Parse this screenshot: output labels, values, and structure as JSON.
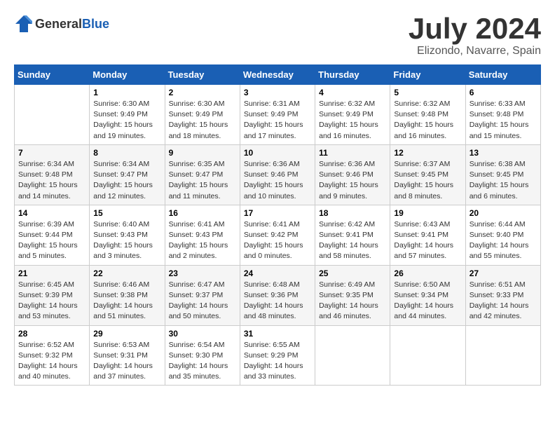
{
  "logo": {
    "general": "General",
    "blue": "Blue"
  },
  "title": "July 2024",
  "location": "Elizondo, Navarre, Spain",
  "days_header": [
    "Sunday",
    "Monday",
    "Tuesday",
    "Wednesday",
    "Thursday",
    "Friday",
    "Saturday"
  ],
  "weeks": [
    [
      {
        "day": "",
        "info": ""
      },
      {
        "day": "1",
        "info": "Sunrise: 6:30 AM\nSunset: 9:49 PM\nDaylight: 15 hours\nand 19 minutes."
      },
      {
        "day": "2",
        "info": "Sunrise: 6:30 AM\nSunset: 9:49 PM\nDaylight: 15 hours\nand 18 minutes."
      },
      {
        "day": "3",
        "info": "Sunrise: 6:31 AM\nSunset: 9:49 PM\nDaylight: 15 hours\nand 17 minutes."
      },
      {
        "day": "4",
        "info": "Sunrise: 6:32 AM\nSunset: 9:49 PM\nDaylight: 15 hours\nand 16 minutes."
      },
      {
        "day": "5",
        "info": "Sunrise: 6:32 AM\nSunset: 9:48 PM\nDaylight: 15 hours\nand 16 minutes."
      },
      {
        "day": "6",
        "info": "Sunrise: 6:33 AM\nSunset: 9:48 PM\nDaylight: 15 hours\nand 15 minutes."
      }
    ],
    [
      {
        "day": "7",
        "info": "Sunrise: 6:34 AM\nSunset: 9:48 PM\nDaylight: 15 hours\nand 14 minutes."
      },
      {
        "day": "8",
        "info": "Sunrise: 6:34 AM\nSunset: 9:47 PM\nDaylight: 15 hours\nand 12 minutes."
      },
      {
        "day": "9",
        "info": "Sunrise: 6:35 AM\nSunset: 9:47 PM\nDaylight: 15 hours\nand 11 minutes."
      },
      {
        "day": "10",
        "info": "Sunrise: 6:36 AM\nSunset: 9:46 PM\nDaylight: 15 hours\nand 10 minutes."
      },
      {
        "day": "11",
        "info": "Sunrise: 6:36 AM\nSunset: 9:46 PM\nDaylight: 15 hours\nand 9 minutes."
      },
      {
        "day": "12",
        "info": "Sunrise: 6:37 AM\nSunset: 9:45 PM\nDaylight: 15 hours\nand 8 minutes."
      },
      {
        "day": "13",
        "info": "Sunrise: 6:38 AM\nSunset: 9:45 PM\nDaylight: 15 hours\nand 6 minutes."
      }
    ],
    [
      {
        "day": "14",
        "info": "Sunrise: 6:39 AM\nSunset: 9:44 PM\nDaylight: 15 hours\nand 5 minutes."
      },
      {
        "day": "15",
        "info": "Sunrise: 6:40 AM\nSunset: 9:43 PM\nDaylight: 15 hours\nand 3 minutes."
      },
      {
        "day": "16",
        "info": "Sunrise: 6:41 AM\nSunset: 9:43 PM\nDaylight: 15 hours\nand 2 minutes."
      },
      {
        "day": "17",
        "info": "Sunrise: 6:41 AM\nSunset: 9:42 PM\nDaylight: 15 hours\nand 0 minutes."
      },
      {
        "day": "18",
        "info": "Sunrise: 6:42 AM\nSunset: 9:41 PM\nDaylight: 14 hours\nand 58 minutes."
      },
      {
        "day": "19",
        "info": "Sunrise: 6:43 AM\nSunset: 9:41 PM\nDaylight: 14 hours\nand 57 minutes."
      },
      {
        "day": "20",
        "info": "Sunrise: 6:44 AM\nSunset: 9:40 PM\nDaylight: 14 hours\nand 55 minutes."
      }
    ],
    [
      {
        "day": "21",
        "info": "Sunrise: 6:45 AM\nSunset: 9:39 PM\nDaylight: 14 hours\nand 53 minutes."
      },
      {
        "day": "22",
        "info": "Sunrise: 6:46 AM\nSunset: 9:38 PM\nDaylight: 14 hours\nand 51 minutes."
      },
      {
        "day": "23",
        "info": "Sunrise: 6:47 AM\nSunset: 9:37 PM\nDaylight: 14 hours\nand 50 minutes."
      },
      {
        "day": "24",
        "info": "Sunrise: 6:48 AM\nSunset: 9:36 PM\nDaylight: 14 hours\nand 48 minutes."
      },
      {
        "day": "25",
        "info": "Sunrise: 6:49 AM\nSunset: 9:35 PM\nDaylight: 14 hours\nand 46 minutes."
      },
      {
        "day": "26",
        "info": "Sunrise: 6:50 AM\nSunset: 9:34 PM\nDaylight: 14 hours\nand 44 minutes."
      },
      {
        "day": "27",
        "info": "Sunrise: 6:51 AM\nSunset: 9:33 PM\nDaylight: 14 hours\nand 42 minutes."
      }
    ],
    [
      {
        "day": "28",
        "info": "Sunrise: 6:52 AM\nSunset: 9:32 PM\nDaylight: 14 hours\nand 40 minutes."
      },
      {
        "day": "29",
        "info": "Sunrise: 6:53 AM\nSunset: 9:31 PM\nDaylight: 14 hours\nand 37 minutes."
      },
      {
        "day": "30",
        "info": "Sunrise: 6:54 AM\nSunset: 9:30 PM\nDaylight: 14 hours\nand 35 minutes."
      },
      {
        "day": "31",
        "info": "Sunrise: 6:55 AM\nSunset: 9:29 PM\nDaylight: 14 hours\nand 33 minutes."
      },
      {
        "day": "",
        "info": ""
      },
      {
        "day": "",
        "info": ""
      },
      {
        "day": "",
        "info": ""
      }
    ]
  ]
}
